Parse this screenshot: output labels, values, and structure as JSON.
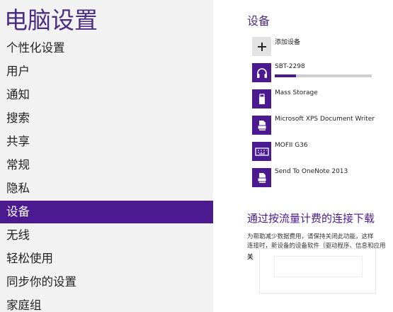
{
  "app": {
    "title": "电脑设置"
  },
  "nav": {
    "items": [
      {
        "label": "个性化设置",
        "selected": false
      },
      {
        "label": "用户",
        "selected": false
      },
      {
        "label": "通知",
        "selected": false
      },
      {
        "label": "搜索",
        "selected": false
      },
      {
        "label": "共享",
        "selected": false
      },
      {
        "label": "常规",
        "selected": false
      },
      {
        "label": "隐私",
        "selected": false
      },
      {
        "label": "设备",
        "selected": true
      },
      {
        "label": "无线",
        "selected": false
      },
      {
        "label": "轻松使用",
        "selected": false
      },
      {
        "label": "同步你的设置",
        "selected": false
      },
      {
        "label": "家庭组",
        "selected": false
      }
    ]
  },
  "devices": {
    "title": "设备",
    "add_label": "添加设备",
    "items": [
      {
        "name": "SBT-2298",
        "icon": "headset-icon",
        "progress": 0.22
      },
      {
        "name": "Mass Storage",
        "icon": "usb-drive-icon"
      },
      {
        "name": "Microsoft XPS Document Writer",
        "icon": "printer-icon"
      },
      {
        "name": "MOFII G36",
        "icon": "keyboard-icon"
      },
      {
        "name": "Send To OneNote 2013",
        "icon": "printer-icon"
      }
    ]
  },
  "metered": {
    "title": "通过按流量计费的连接下载",
    "line1": "为帮助减少数据费用，请保持关闭此功能，这样",
    "line2": "连接时，新设备的设备软件（驱动程序、信息和应用",
    "line3": "关"
  },
  "colors": {
    "accent": "#4b1a91",
    "title": "#4b2e83",
    "left_pane_bg": "#f2f2f2"
  }
}
